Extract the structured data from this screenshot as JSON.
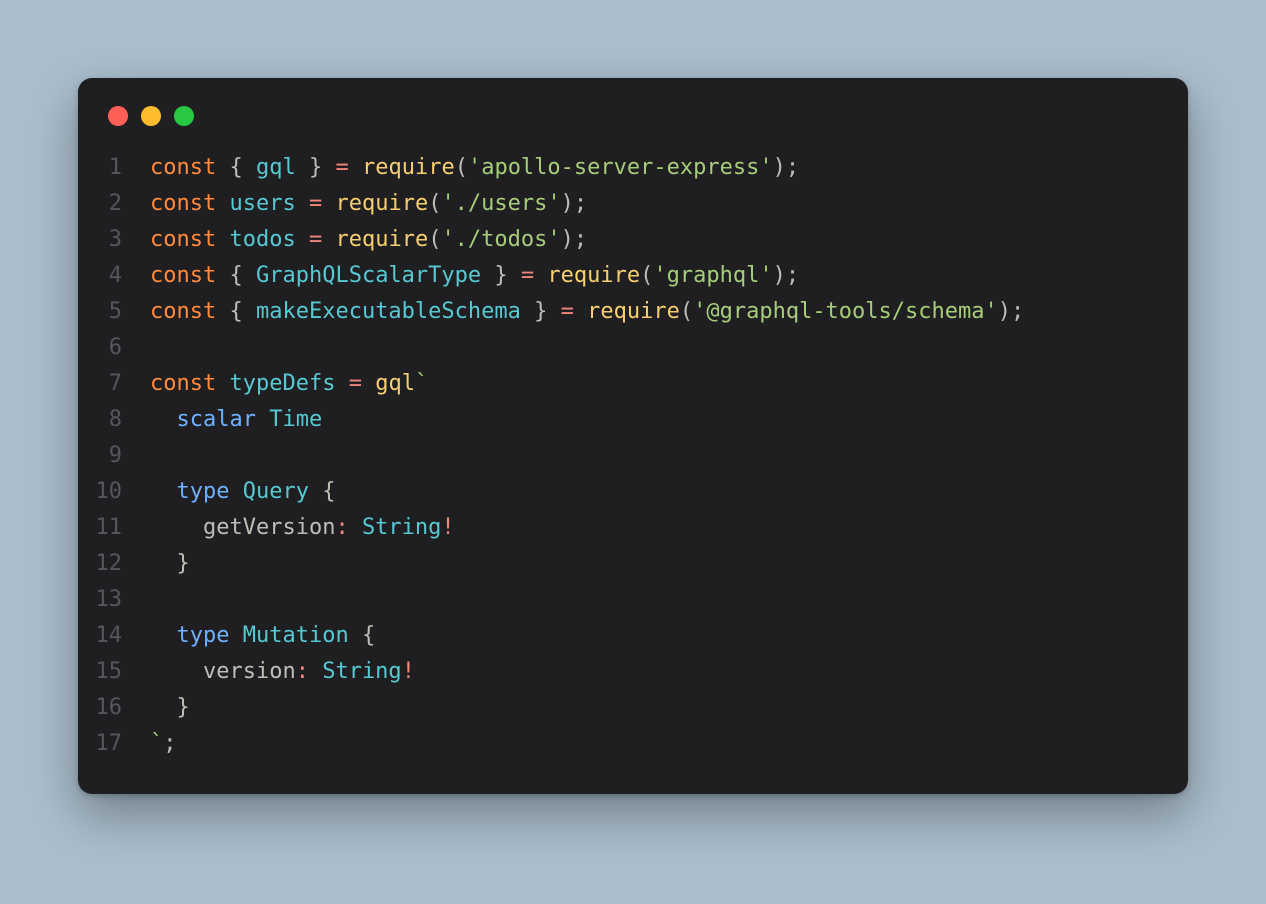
{
  "window": {
    "dots": [
      "red",
      "yellow",
      "green"
    ]
  },
  "code": {
    "lines": [
      {
        "n": "1",
        "tokens": [
          {
            "c": "k",
            "t": "const"
          },
          {
            "c": "p",
            "t": " { "
          },
          {
            "c": "i2",
            "t": "gql"
          },
          {
            "c": "p",
            "t": " } "
          },
          {
            "c": "op",
            "t": "="
          },
          {
            "c": "p",
            "t": " "
          },
          {
            "c": "fn",
            "t": "require"
          },
          {
            "c": "p",
            "t": "("
          },
          {
            "c": "s",
            "t": "'apollo-server-express'"
          },
          {
            "c": "p",
            "t": ");"
          }
        ]
      },
      {
        "n": "2",
        "tokens": [
          {
            "c": "k",
            "t": "const"
          },
          {
            "c": "p",
            "t": " "
          },
          {
            "c": "i2",
            "t": "users"
          },
          {
            "c": "p",
            "t": " "
          },
          {
            "c": "op",
            "t": "="
          },
          {
            "c": "p",
            "t": " "
          },
          {
            "c": "fn",
            "t": "require"
          },
          {
            "c": "p",
            "t": "("
          },
          {
            "c": "s",
            "t": "'./users'"
          },
          {
            "c": "p",
            "t": ");"
          }
        ]
      },
      {
        "n": "3",
        "tokens": [
          {
            "c": "k",
            "t": "const"
          },
          {
            "c": "p",
            "t": " "
          },
          {
            "c": "i2",
            "t": "todos"
          },
          {
            "c": "p",
            "t": " "
          },
          {
            "c": "op",
            "t": "="
          },
          {
            "c": "p",
            "t": " "
          },
          {
            "c": "fn",
            "t": "require"
          },
          {
            "c": "p",
            "t": "("
          },
          {
            "c": "s",
            "t": "'./todos'"
          },
          {
            "c": "p",
            "t": ");"
          }
        ]
      },
      {
        "n": "4",
        "tokens": [
          {
            "c": "k",
            "t": "const"
          },
          {
            "c": "p",
            "t": " { "
          },
          {
            "c": "i2",
            "t": "GraphQLScalarType"
          },
          {
            "c": "p",
            "t": " } "
          },
          {
            "c": "op",
            "t": "="
          },
          {
            "c": "p",
            "t": " "
          },
          {
            "c": "fn",
            "t": "require"
          },
          {
            "c": "p",
            "t": "("
          },
          {
            "c": "s",
            "t": "'graphql'"
          },
          {
            "c": "p",
            "t": ");"
          }
        ]
      },
      {
        "n": "5",
        "tokens": [
          {
            "c": "k",
            "t": "const"
          },
          {
            "c": "p",
            "t": " { "
          },
          {
            "c": "i2",
            "t": "makeExecutableSchema"
          },
          {
            "c": "p",
            "t": " } "
          },
          {
            "c": "op",
            "t": "="
          },
          {
            "c": "p",
            "t": " "
          },
          {
            "c": "fn",
            "t": "require"
          },
          {
            "c": "p",
            "t": "("
          },
          {
            "c": "s",
            "t": "'@graphql-tools/schema'"
          },
          {
            "c": "p",
            "t": ");"
          }
        ]
      },
      {
        "n": "6",
        "tokens": [
          {
            "c": "p",
            "t": ""
          }
        ]
      },
      {
        "n": "7",
        "tokens": [
          {
            "c": "k",
            "t": "const"
          },
          {
            "c": "p",
            "t": " "
          },
          {
            "c": "i2",
            "t": "typeDefs"
          },
          {
            "c": "p",
            "t": " "
          },
          {
            "c": "op",
            "t": "="
          },
          {
            "c": "p",
            "t": " "
          },
          {
            "c": "fn",
            "t": "gql"
          },
          {
            "c": "s",
            "t": "`"
          }
        ]
      },
      {
        "n": "8",
        "tokens": [
          {
            "c": "p",
            "t": "  "
          },
          {
            "c": "kw",
            "t": "scalar"
          },
          {
            "c": "p",
            "t": " "
          },
          {
            "c": "i2",
            "t": "Time"
          }
        ]
      },
      {
        "n": "9",
        "tokens": [
          {
            "c": "p",
            "t": ""
          }
        ]
      },
      {
        "n": "10",
        "tokens": [
          {
            "c": "p",
            "t": "  "
          },
          {
            "c": "kw",
            "t": "type"
          },
          {
            "c": "p",
            "t": " "
          },
          {
            "c": "i2",
            "t": "Query"
          },
          {
            "c": "p",
            "t": " {"
          }
        ]
      },
      {
        "n": "11",
        "tokens": [
          {
            "c": "p",
            "t": "    "
          },
          {
            "c": "i",
            "t": "getVersion"
          },
          {
            "c": "op",
            "t": ":"
          },
          {
            "c": "p",
            "t": " "
          },
          {
            "c": "i2",
            "t": "String"
          },
          {
            "c": "op",
            "t": "!"
          }
        ]
      },
      {
        "n": "12",
        "tokens": [
          {
            "c": "p",
            "t": "  }"
          }
        ]
      },
      {
        "n": "13",
        "tokens": [
          {
            "c": "p",
            "t": ""
          }
        ]
      },
      {
        "n": "14",
        "tokens": [
          {
            "c": "p",
            "t": "  "
          },
          {
            "c": "kw",
            "t": "type"
          },
          {
            "c": "p",
            "t": " "
          },
          {
            "c": "i2",
            "t": "Mutation"
          },
          {
            "c": "p",
            "t": " {"
          }
        ]
      },
      {
        "n": "15",
        "tokens": [
          {
            "c": "p",
            "t": "    "
          },
          {
            "c": "i",
            "t": "version"
          },
          {
            "c": "op",
            "t": ":"
          },
          {
            "c": "p",
            "t": " "
          },
          {
            "c": "i2",
            "t": "String"
          },
          {
            "c": "op",
            "t": "!"
          }
        ]
      },
      {
        "n": "16",
        "tokens": [
          {
            "c": "p",
            "t": "  }"
          }
        ]
      },
      {
        "n": "17",
        "tokens": [
          {
            "c": "s",
            "t": "`"
          },
          {
            "c": "p",
            "t": ";"
          }
        ]
      }
    ]
  }
}
